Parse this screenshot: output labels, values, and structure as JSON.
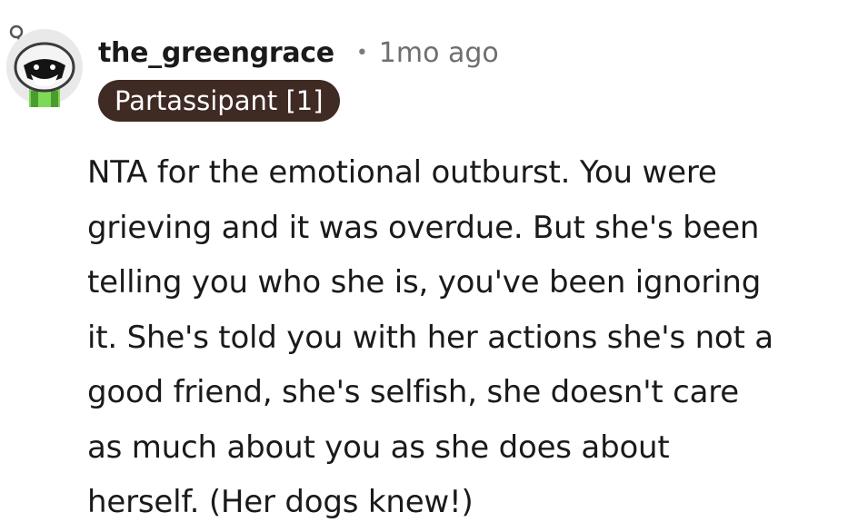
{
  "comment": {
    "username": "the_greengrace",
    "separator": "•",
    "timestamp": "1mo ago",
    "flair": "Partassipant [1]",
    "avatar_icon": "snoo-avatar-icon",
    "body_lines": [
      "NTA for the emotional outburst. You were",
      "grieving and it was overdue. But she's been",
      "telling you who she is, you've been ignoring",
      "it. She's told you with her actions she's not a",
      "good friend, she's selfish, she doesn't care",
      "as much about you as she does about",
      "herself. (Her dogs knew!)"
    ]
  },
  "colors": {
    "flair_bg": "#3f2a24",
    "text": "#1a1a1b",
    "muted": "#6f6f6f",
    "avatar_green": "#7ed957"
  }
}
